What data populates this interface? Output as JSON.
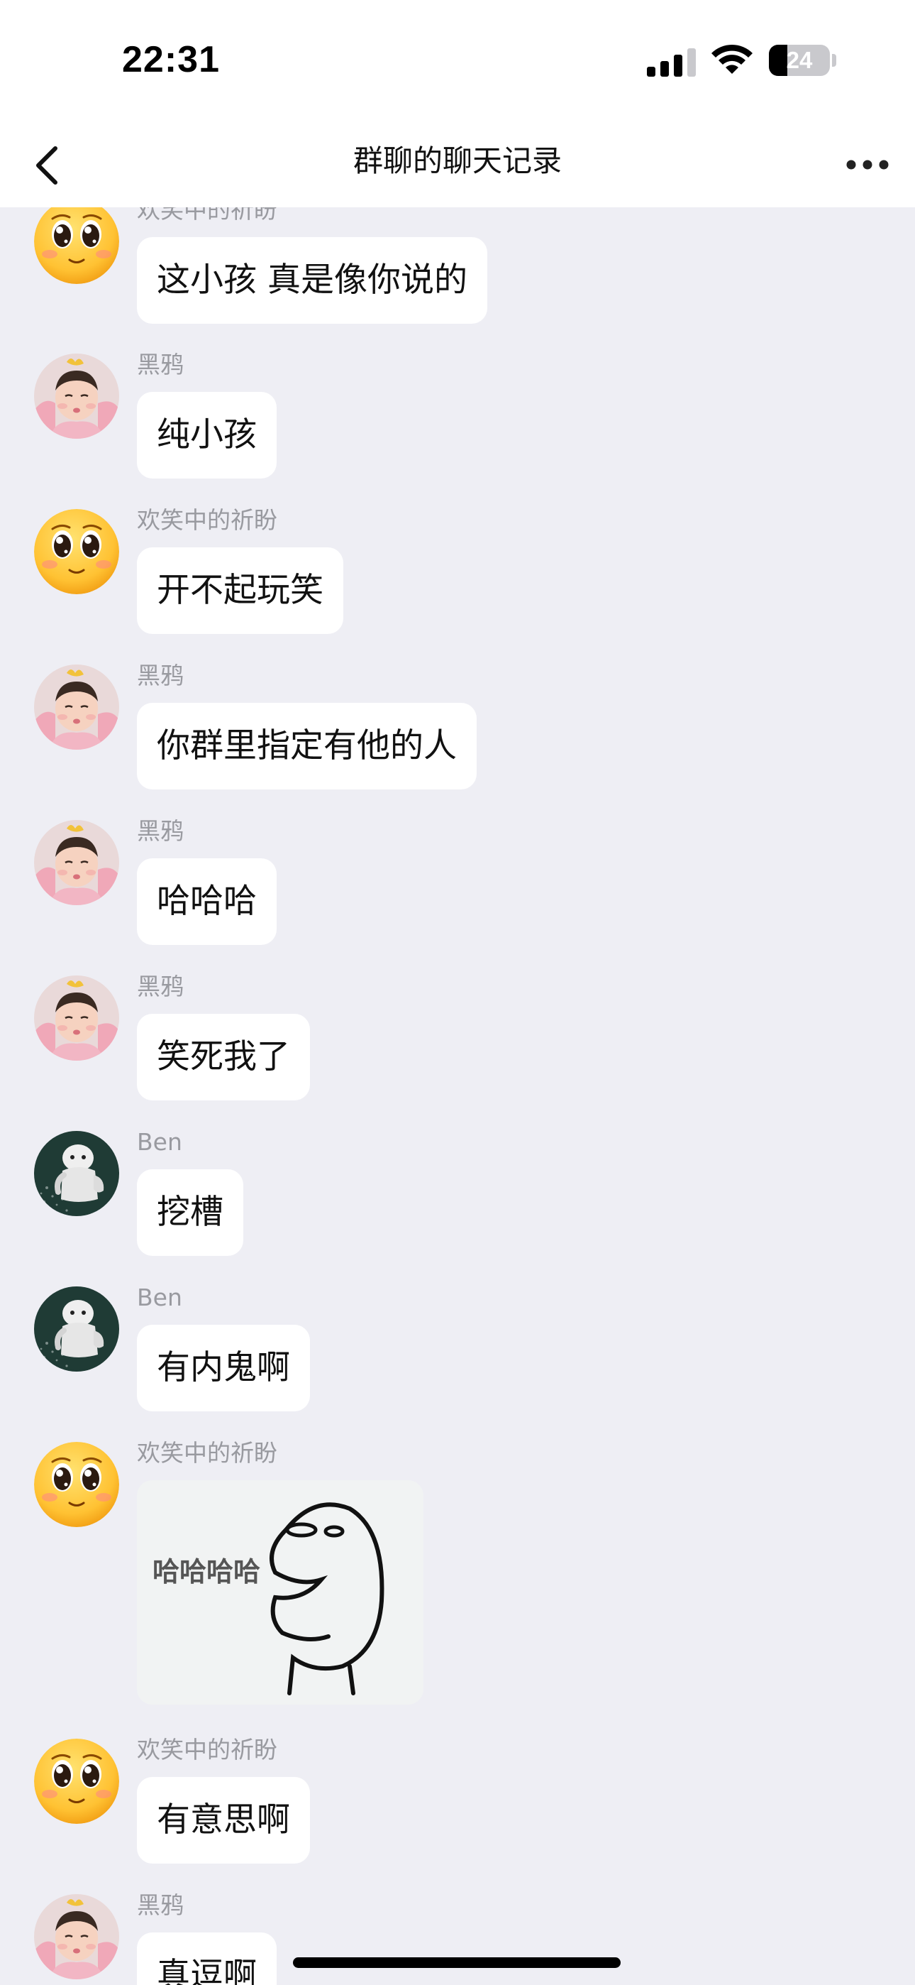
{
  "status_bar": {
    "time": "22:31",
    "battery": "24"
  },
  "nav": {
    "title": "群聊的聊天记录"
  },
  "messages": [
    {
      "sender": "欢笑中的祈盼",
      "avatar": "emoji-face-avatar",
      "type": "text",
      "text": "这小孩 真是像你说的"
    },
    {
      "sender": "黑鸦",
      "avatar": "child-photo-avatar",
      "type": "text",
      "text": "纯小孩"
    },
    {
      "sender": "欢笑中的祈盼",
      "avatar": "emoji-face-avatar",
      "type": "text",
      "text": "开不起玩笑"
    },
    {
      "sender": "黑鸦",
      "avatar": "child-photo-avatar",
      "type": "text",
      "text": "你群里指定有他的人"
    },
    {
      "sender": "黑鸦",
      "avatar": "child-photo-avatar",
      "type": "text",
      "text": "哈哈哈"
    },
    {
      "sender": "黑鸦",
      "avatar": "child-photo-avatar",
      "type": "text",
      "text": "笑死我了"
    },
    {
      "sender": "Ben",
      "avatar": "ghost-figure-avatar",
      "type": "text",
      "text": "挖槽"
    },
    {
      "sender": "Ben",
      "avatar": "ghost-figure-avatar",
      "type": "text",
      "text": "有内鬼啊"
    },
    {
      "sender": "欢笑中的祈盼",
      "avatar": "emoji-face-avatar",
      "type": "sticker",
      "sticker_text": "哈哈哈哈"
    },
    {
      "sender": "欢笑中的祈盼",
      "avatar": "emoji-face-avatar",
      "type": "text",
      "text": "有意思啊"
    },
    {
      "sender": "黑鸦",
      "avatar": "child-photo-avatar",
      "type": "text",
      "text": "真逗啊"
    }
  ],
  "colors": {
    "background": "#eeeef4",
    "bubble": "#ffffff",
    "sender_name": "#999aa0",
    "text": "#111111"
  }
}
